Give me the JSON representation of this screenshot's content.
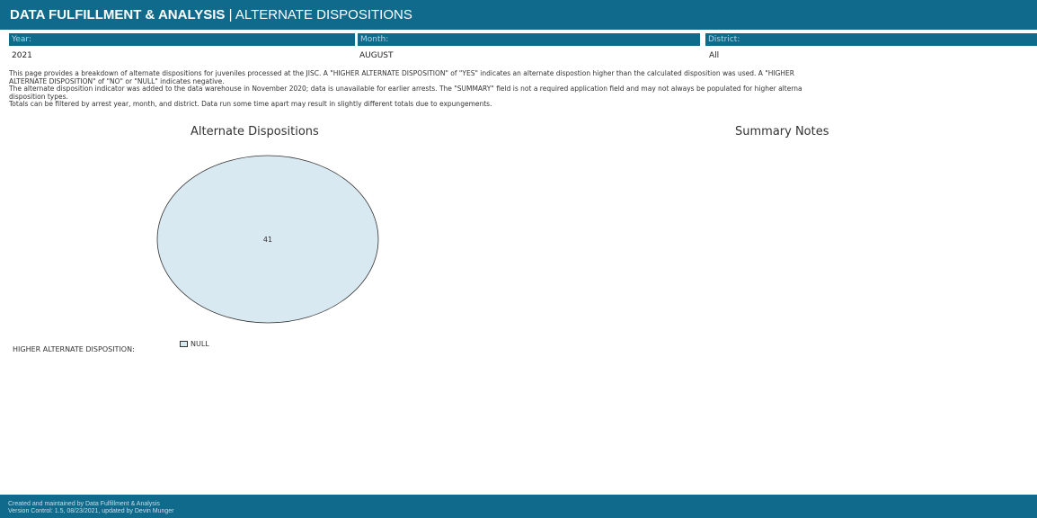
{
  "header": {
    "title_bold": "DATA FULFILLMENT & ANALYSIS",
    "title_separator": " | ",
    "title_rest": "ALTERNATE DISPOSITIONS",
    "background": "#0f6a8b"
  },
  "filters": {
    "year": {
      "label": "Year:",
      "value": "2021"
    },
    "month": {
      "label": "Month:",
      "value": "AUGUST"
    },
    "district": {
      "label": "District:",
      "value": "All"
    }
  },
  "description": [
    "This page provides a breakdown of alternate dispositions for juveniles processed at the JISC. A \"HIGHER ALTERNATE DISPOSITION\" of \"YES\" indicates an alternate dispostion higher than the calculated disposition was used. A \"HIGHER",
    "ALTERNATE DISPOSITION\" of \"NO\" or \"NULL\" indicates negative.",
    "The alternate disposition indicator was added to the data warehouse in November 2020; data is unavailable for earlier arrests. The \"SUMMARY\" field is not a required application field and may not always be populated for higher alterna",
    "disposition types.",
    "Totals can be filtered by arrest year, month, and district. Data run some time apart may result in slightly different totals due to expungements."
  ],
  "sections": {
    "alternate_dispositions_title": "Alternate Dispositions",
    "summary_notes_title": "Summary Notes"
  },
  "legend": {
    "label": "HIGHER ALTERNATE DISPOSITION:",
    "items": [
      {
        "name": "NULL",
        "color": "#d9e9f2"
      }
    ]
  },
  "chart_data": {
    "type": "pie",
    "title": "Alternate Dispositions",
    "categories": [
      "NULL"
    ],
    "values": [
      41
    ],
    "data_labels": [
      "41"
    ],
    "colors": [
      "#d9e9f2"
    ],
    "legend_placement": "bottom-left"
  },
  "footer": {
    "line1": "Created and maintained by Data Fulfillment & Analysis",
    "line2": "Version Control: 1.5, 08/23/2021, updated by Devin Munger"
  }
}
